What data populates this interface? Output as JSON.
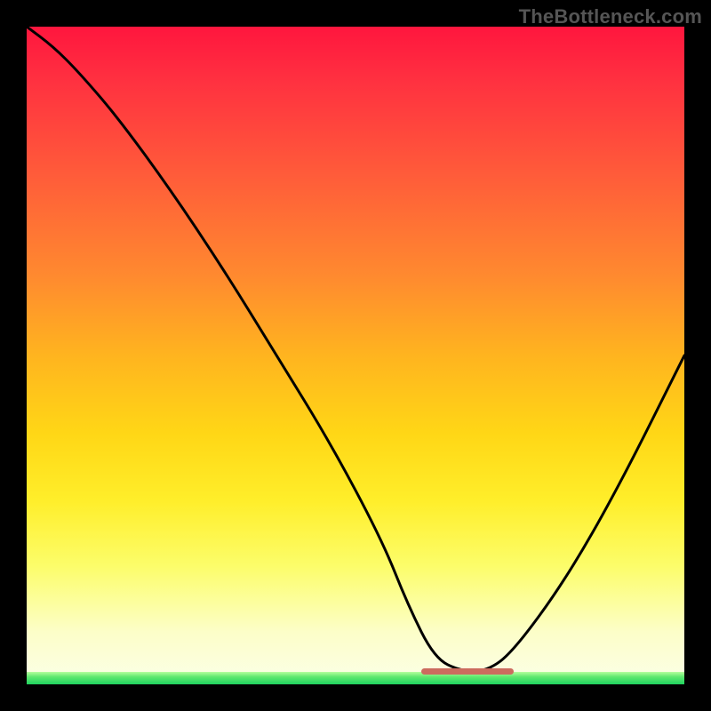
{
  "watermark": "TheBottleneck.com",
  "chart_data": {
    "type": "line",
    "title": "",
    "xlabel": "",
    "ylabel": "",
    "xlim": [
      0,
      100
    ],
    "ylim": [
      0,
      100
    ],
    "grid": false,
    "legend": false,
    "series": [
      {
        "name": "bottleneck-curve",
        "color": "#000000",
        "x": [
          0,
          4,
          8,
          14,
          22,
          30,
          38,
          46,
          54,
          58,
          62,
          66,
          70,
          74,
          82,
          90,
          100
        ],
        "values": [
          100,
          97,
          93,
          86,
          75,
          63,
          50,
          37,
          22,
          12,
          4,
          2,
          2,
          5,
          16,
          30,
          50
        ]
      }
    ],
    "min_marker": {
      "x_start": 60,
      "x_end": 74,
      "y": 2,
      "color": "#cc6b5e"
    },
    "background_gradient": {
      "top": "#ff163e",
      "bottom_band": "#1fd35f"
    }
  }
}
